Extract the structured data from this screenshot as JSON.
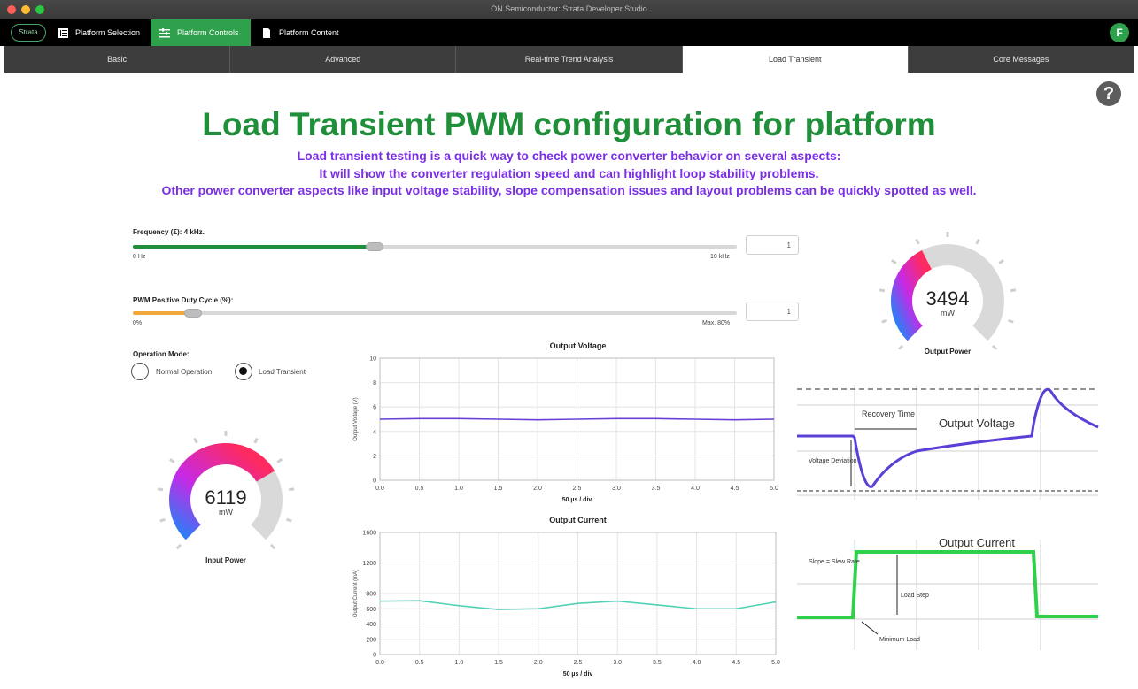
{
  "window": {
    "title": "ON Semiconductor: Strata Developer Studio",
    "traffic_colors": [
      "#ff5f57",
      "#febc2e",
      "#28c840"
    ]
  },
  "topbar": {
    "logo_text": "Strata",
    "nav": [
      {
        "label": "Platform Selection",
        "icon": "grid-icon",
        "active": false
      },
      {
        "label": "Platform Controls",
        "icon": "sliders-icon",
        "active": true
      },
      {
        "label": "Platform Content",
        "icon": "document-icon",
        "active": false
      }
    ],
    "avatar_initial": "F"
  },
  "tabs": [
    {
      "label": "Basic",
      "active": false
    },
    {
      "label": "Advanced",
      "active": false
    },
    {
      "label": "Real-time Trend Analysis",
      "active": false
    },
    {
      "label": "Load Transient",
      "active": true
    },
    {
      "label": "Core Messages",
      "active": false
    }
  ],
  "help_glyph": "?",
  "page_title": "Load Transient PWM configuration for platform",
  "description": [
    "Load transient testing is a quick way to check power converter behavior on several aspects:",
    "It will show the converter regulation speed and can highlight loop stability problems.",
    "Other power converter aspects like input voltage stability, slope compensation issues and layout problems can be quickly spotted as well."
  ],
  "frequency": {
    "label": "Frequency (Σ): 4 kHz.",
    "min_label": "0 Hz",
    "max_label": "10 kHz",
    "value_fraction": 0.4,
    "input_value": "1"
  },
  "duty": {
    "label": "PWM Positive Duty Cycle (%):",
    "min_label": "0%",
    "max_label": "Max. 80%",
    "value_fraction": 0.1,
    "input_value": "1"
  },
  "mode": {
    "label": "Operation Mode:",
    "options": [
      {
        "label": "Normal Operation",
        "selected": false
      },
      {
        "label": "Load Transient",
        "selected": true
      }
    ]
  },
  "input_gauge": {
    "value": "6119",
    "unit": "mW",
    "label": "Input Power",
    "fraction": 0.72
  },
  "output_gauge": {
    "value": "3494",
    "unit": "mW",
    "label": "Output Power",
    "fraction": 0.4
  },
  "chart_data": [
    {
      "type": "line",
      "title": "Output Voltage",
      "xlabel": "50 µs / div",
      "ylabel": "Output Voltage (V)",
      "xlim": [
        0,
        5
      ],
      "ylim": [
        0,
        10
      ],
      "xticks": [
        "0.0",
        "0.5",
        "1.0",
        "1.5",
        "2.0",
        "2.5",
        "3.0",
        "3.5",
        "4.0",
        "4.5",
        "5.0"
      ],
      "yticks": [
        "0",
        "2",
        "4",
        "6",
        "8",
        "10"
      ],
      "color": "#6a3fd6",
      "x": [
        0,
        0.5,
        1.0,
        1.5,
        2.0,
        2.5,
        3.0,
        3.5,
        4.0,
        4.5,
        5.0
      ],
      "values": [
        5.0,
        5.05,
        5.05,
        5.0,
        4.95,
        5.0,
        5.05,
        5.05,
        5.0,
        4.95,
        5.0
      ]
    },
    {
      "type": "line",
      "title": "Output Current",
      "xlabel": "50 µs / div",
      "ylabel": "Output Current (mA)",
      "xlim": [
        0,
        5
      ],
      "ylim": [
        0,
        1600
      ],
      "xticks": [
        "0.0",
        "0.5",
        "1.0",
        "1.5",
        "2.0",
        "2.5",
        "3.0",
        "3.5",
        "4.0",
        "4.5",
        "5.0"
      ],
      "yticks": [
        "0",
        "200",
        "400",
        "600",
        "800",
        "1200",
        "1600"
      ],
      "color": "#4fd1b5",
      "x": [
        0,
        0.5,
        1.0,
        1.5,
        2.0,
        2.5,
        3.0,
        3.5,
        4.0,
        4.5,
        5.0
      ],
      "values": [
        700,
        705,
        640,
        590,
        600,
        670,
        700,
        650,
        600,
        600,
        690
      ]
    }
  ],
  "diagram": {
    "voltage_title": "Output Voltage",
    "recovery_label": "Recovery Time",
    "deviation_label": "Voltage Deviation",
    "current_title": "Output Current",
    "slope_label": "Slope = Slew Rate",
    "step_label": "Load Step",
    "min_load_label": "Minimum Load"
  }
}
